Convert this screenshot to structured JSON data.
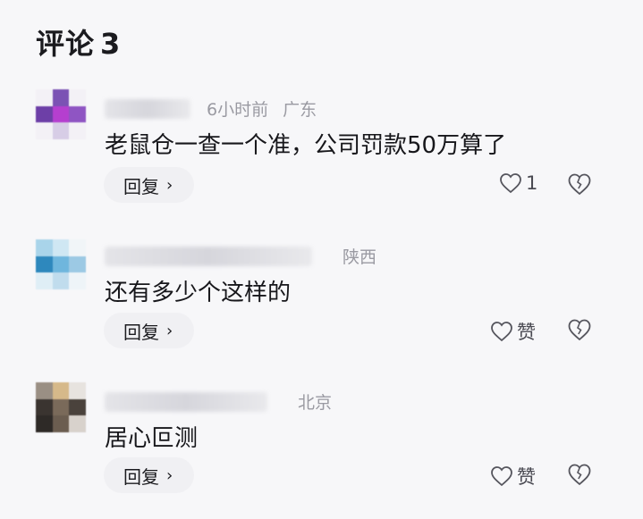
{
  "header": {
    "title": "评论",
    "count": "3"
  },
  "comments": [
    {
      "time": "6小时前",
      "location": "广东",
      "text": "老鼠仓一查一个准，公司罚款50万算了",
      "reply_label": "回复",
      "like_label": "1"
    },
    {
      "time": "",
      "location": "陕西",
      "text": "还有多少个这样的",
      "reply_label": "回复",
      "like_label": "赞"
    },
    {
      "time": "",
      "location": "北京",
      "text": "居心叵测",
      "reply_label": "回复",
      "like_label": "赞"
    }
  ],
  "icons": {
    "like": "heart-outline-icon",
    "dislike": "broken-heart-icon",
    "chevron": "chevron-right-icon"
  },
  "colors": {
    "background": "#f7f7f9",
    "meta_text": "#9a9aa2",
    "reply_bg": "#f0f0f3"
  }
}
